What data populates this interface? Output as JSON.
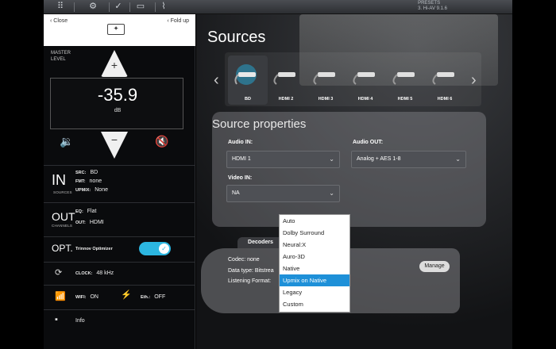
{
  "topbar": {
    "presets_line1": "PRESETS",
    "presets_line2": "3. Hi-AV 9.1.6"
  },
  "sidebar": {
    "close_label": "Close",
    "fold_label": "Fold up",
    "master_label": "MASTER LEVEL",
    "volume_value": "-35.9",
    "volume_unit": "dB",
    "in": {
      "big": "IN",
      "small": "SOURCES",
      "src_key": "SRC:",
      "src_val": "BD",
      "fmt_key": "FMT:",
      "fmt_val": "none",
      "upmix_key": "UPMIX:",
      "upmix_val": "None"
    },
    "out": {
      "big": "OUT",
      "small": "CHANNELS",
      "eq_key": "EQ:",
      "eq_val": "Flat",
      "out_key": "OUT:",
      "out_val": "HDMI"
    },
    "opt": {
      "big": "OPT.",
      "label": "Trinnov Optimizer",
      "toggle_on": true
    },
    "clock": {
      "key": "CLOCK:",
      "val": "48 kHz"
    },
    "wifi": {
      "key": "WIFI:",
      "val": "ON"
    },
    "eth": {
      "key": "Eth.:",
      "val": "OFF"
    },
    "info_label": "Info"
  },
  "main": {
    "title": "Sources",
    "sources": [
      {
        "label": "BD",
        "selected": true
      },
      {
        "label": "HDMI 2",
        "selected": false
      },
      {
        "label": "HDMI 3",
        "selected": false
      },
      {
        "label": "HDMI 4",
        "selected": false
      },
      {
        "label": "HDMI 5",
        "selected": false
      },
      {
        "label": "HDMI 6",
        "selected": false
      }
    ],
    "props_title": "Source properties",
    "audio_in_label": "Audio IN:",
    "audio_in_value": "HDMI 1",
    "audio_out_label": "Audio OUT:",
    "audio_out_value": "Analog + AES 1-8",
    "video_in_label": "Video IN:",
    "video_in_value": "NA",
    "decoders_tab": "Decoders",
    "codec_line": "Codec: none",
    "datatype_line": "Data type: Bitstrea",
    "listening_line": "Listening Format:",
    "manage_label": "Manage",
    "dropdown_items": [
      "Auto",
      "Dolby Surround",
      "Neural:X",
      "Auro-3D",
      "Native",
      "Upmix on Native",
      "Legacy",
      "Custom"
    ],
    "dropdown_selected": "Upmix on Native"
  },
  "colors": {
    "accent": "#2cb6e0",
    "dropdown_highlight": "#1e90d8"
  }
}
